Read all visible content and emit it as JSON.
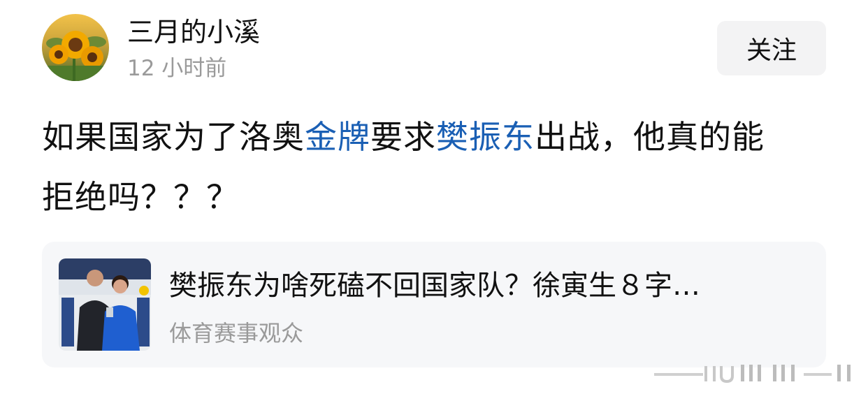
{
  "post": {
    "author": {
      "name": "三月的小溪",
      "time": "12 小时前",
      "avatar_icon": "sunflower-avatar-icon"
    },
    "follow_label": "关注",
    "text": {
      "line1_a": "如果国家为了洛奥",
      "line1_kw1": "金牌",
      "line1_b": "要求",
      "line1_kw2": "樊振东",
      "line1_c": "出战，他真的能",
      "line2": "拒绝吗？？？"
    },
    "keyword_color": "#1a5fb4",
    "linked_article": {
      "title": "樊振东为啥死磕不回国家队？徐寅生８字…",
      "source": "体育赛事观众",
      "thumbnail_icon": "article-photo-thumbnail"
    }
  }
}
